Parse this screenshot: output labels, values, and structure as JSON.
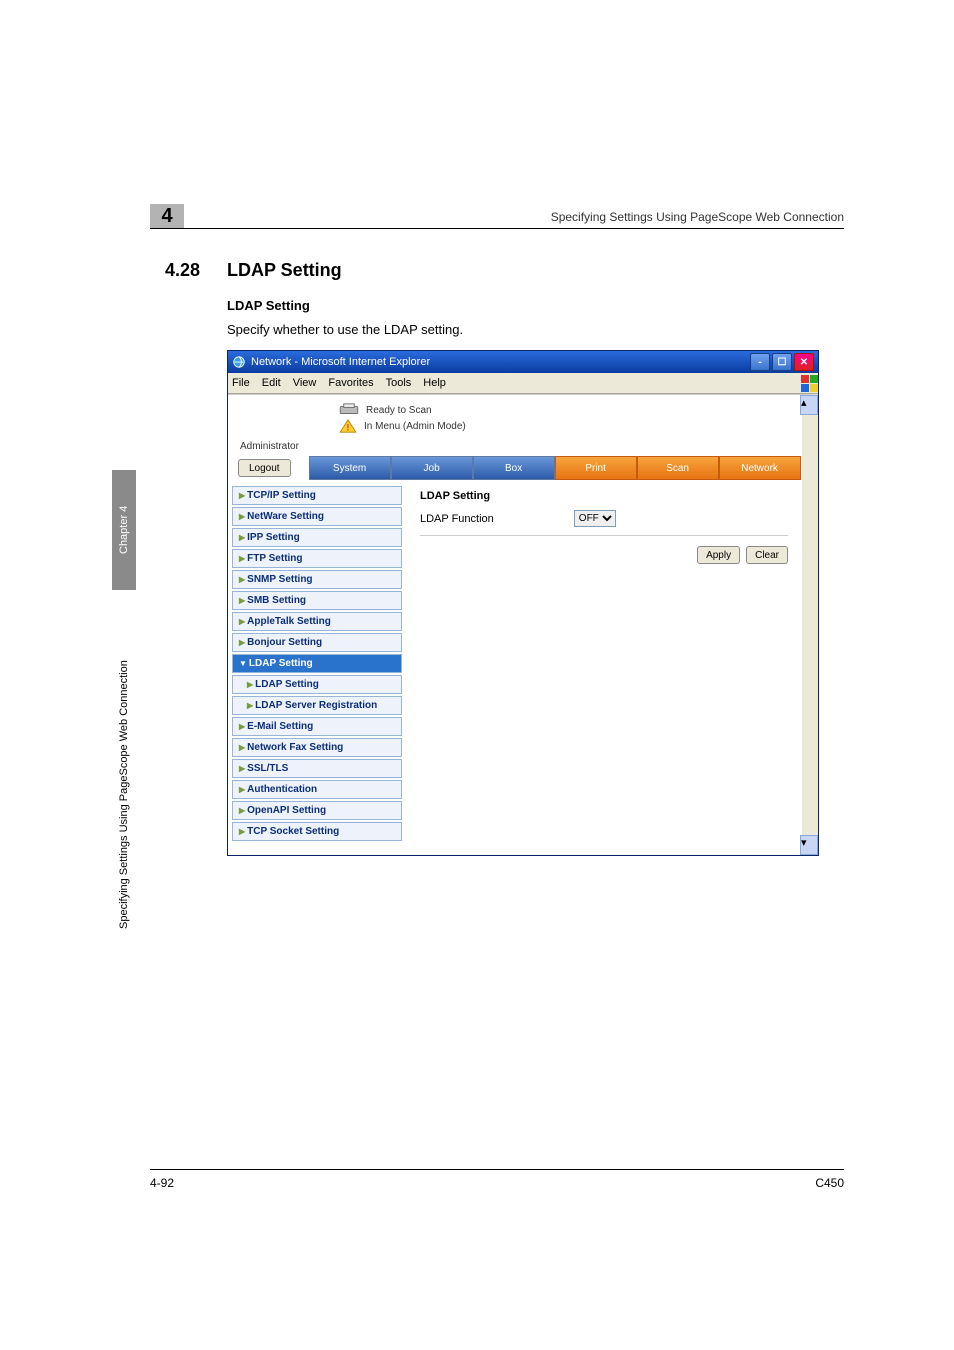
{
  "page": {
    "chapter_number": "4",
    "running_head": "Specifying Settings Using PageScope Web Connection",
    "section_number": "4.28",
    "section_title": "LDAP Setting",
    "sub_heading": "LDAP Setting",
    "body": "Specify whether to use the LDAP setting.",
    "side_chapter": "Chapter 4",
    "side_text": "Specifying Settings Using PageScope Web Connection",
    "footer_left": "4-92",
    "footer_right": "C450"
  },
  "ie": {
    "title": "Network - Microsoft Internet Explorer",
    "menus": [
      "File",
      "Edit",
      "View",
      "Favorites",
      "Tools",
      "Help"
    ],
    "status1": "Ready to Scan",
    "status2": "In Menu (Admin Mode)",
    "admin_label": "Administrator",
    "logout": "Logout",
    "tabs": [
      {
        "label": "System",
        "active": false
      },
      {
        "label": "Job",
        "active": false
      },
      {
        "label": "Box",
        "active": false
      },
      {
        "label": "Print",
        "active": true
      },
      {
        "label": "Scan",
        "active": true
      },
      {
        "label": "Network",
        "active": true
      }
    ],
    "sidebar": [
      {
        "label": "TCP/IP Setting"
      },
      {
        "label": "NetWare Setting"
      },
      {
        "label": "IPP Setting"
      },
      {
        "label": "FTP Setting"
      },
      {
        "label": "SNMP Setting"
      },
      {
        "label": "SMB Setting"
      },
      {
        "label": "AppleTalk Setting"
      },
      {
        "label": "Bonjour Setting"
      },
      {
        "label": "LDAP Setting",
        "active": true
      },
      {
        "label": "LDAP Setting",
        "sub": true
      },
      {
        "label": "LDAP Server Registration",
        "sub": true
      },
      {
        "label": "E-Mail Setting"
      },
      {
        "label": "Network Fax Setting"
      },
      {
        "label": "SSL/TLS"
      },
      {
        "label": "Authentication"
      },
      {
        "label": "OpenAPI Setting"
      },
      {
        "label": "TCP Socket Setting"
      }
    ],
    "main": {
      "title": "LDAP Setting",
      "field_label": "LDAP Function",
      "field_value": "OFF",
      "apply": "Apply",
      "clear": "Clear"
    }
  }
}
